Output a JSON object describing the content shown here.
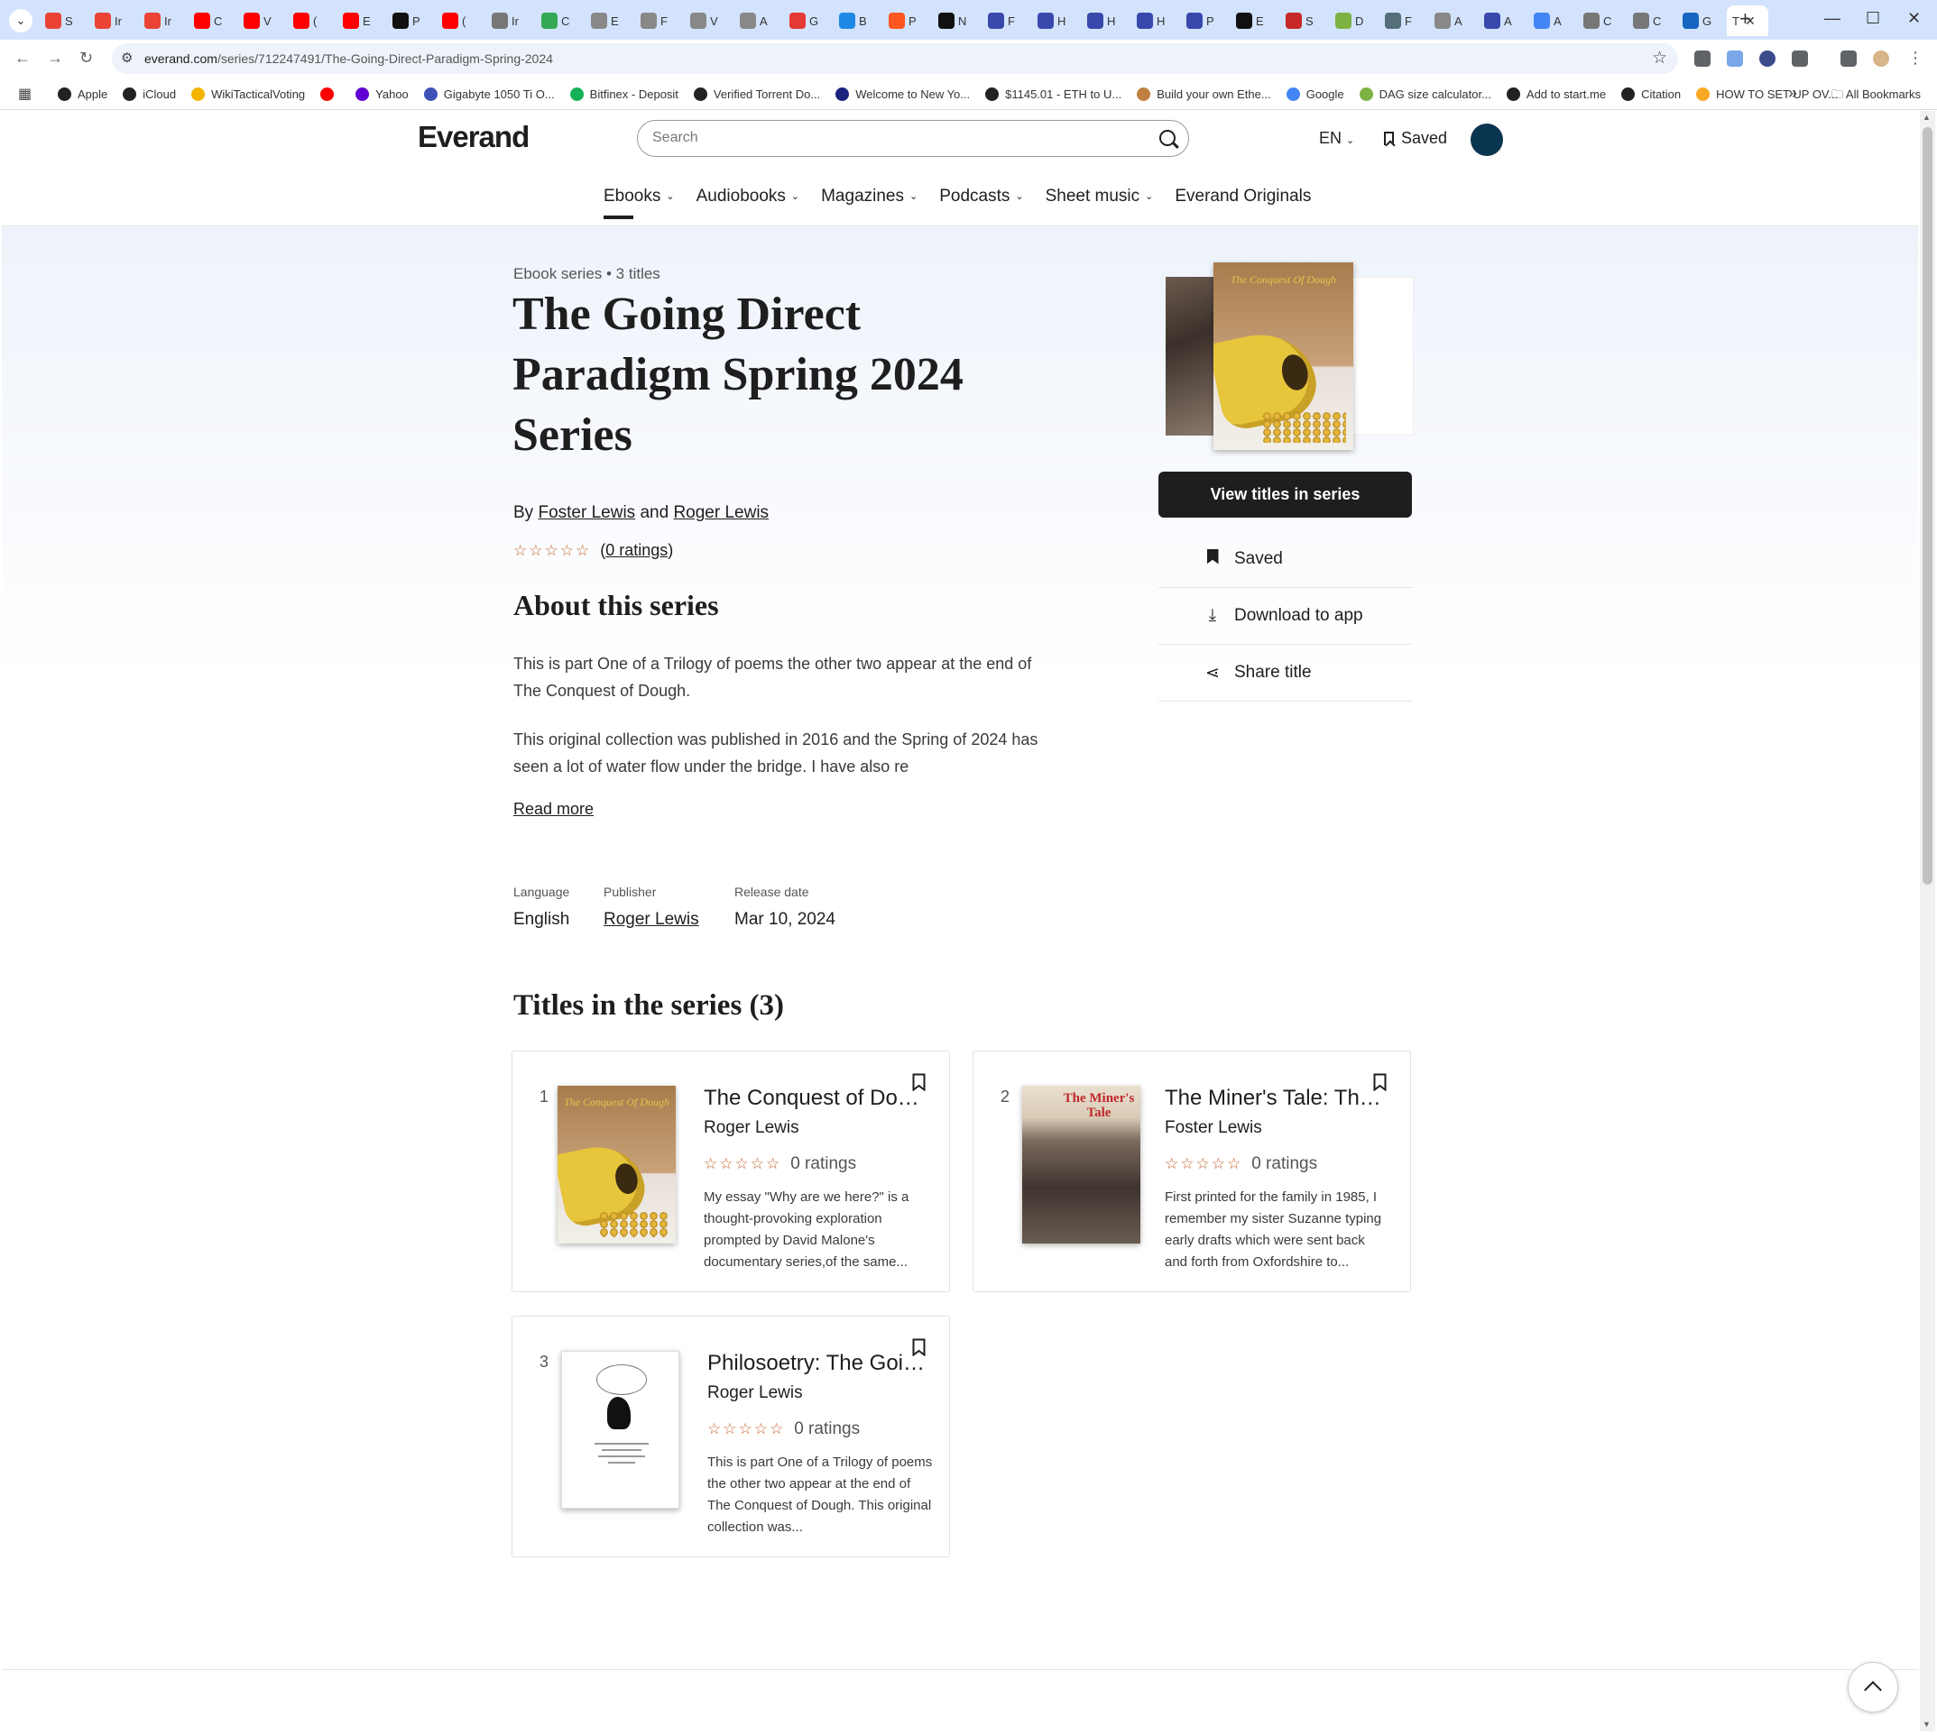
{
  "browser": {
    "tabs": [
      {
        "label": "S",
        "color": "#ea4335"
      },
      {
        "label": "Ir",
        "color": "#ea4335"
      },
      {
        "label": "Ir",
        "color": "#ea4335"
      },
      {
        "label": "C",
        "color": "#ff0000"
      },
      {
        "label": "V",
        "color": "#ff0000"
      },
      {
        "label": "(",
        "color": "#ff0000"
      },
      {
        "label": "E",
        "color": "#ff0000"
      },
      {
        "label": "P",
        "color": "#111111"
      },
      {
        "label": "(",
        "color": "#ff0000"
      },
      {
        "label": "Ir",
        "color": "#777777"
      },
      {
        "label": "C",
        "color": "#34a853"
      },
      {
        "label": "E",
        "color": "#888888"
      },
      {
        "label": "F",
        "color": "#888888"
      },
      {
        "label": "V",
        "color": "#888888"
      },
      {
        "label": "A",
        "color": "#888888"
      },
      {
        "label": "G",
        "color": "#e53935"
      },
      {
        "label": "B",
        "color": "#1e88e5"
      },
      {
        "label": "P",
        "color": "#ff5722"
      },
      {
        "label": "N",
        "color": "#111111"
      },
      {
        "label": "F",
        "color": "#3949ab"
      },
      {
        "label": "H",
        "color": "#3949ab"
      },
      {
        "label": "H",
        "color": "#3949ab"
      },
      {
        "label": "H",
        "color": "#3949ab"
      },
      {
        "label": "P",
        "color": "#3949ab"
      },
      {
        "label": "E",
        "color": "#111111"
      },
      {
        "label": "S",
        "color": "#c62828"
      },
      {
        "label": "D",
        "color": "#7cb342"
      },
      {
        "label": "F",
        "color": "#546e7a"
      },
      {
        "label": "A",
        "color": "#888888"
      },
      {
        "label": "A",
        "color": "#3949ab"
      },
      {
        "label": "A",
        "color": "#4285f4"
      },
      {
        "label": "C",
        "color": "#777777"
      },
      {
        "label": "C",
        "color": "#777777"
      },
      {
        "label": "G",
        "color": "#1565c0"
      }
    ],
    "active_tab": {
      "label": "T",
      "close": "✕"
    },
    "new_tab": "+",
    "url_host": "everand.com",
    "url_path": "/series/712247491/The-Going-Direct-Paradigm-Spring-2024",
    "bookmarks": [
      {
        "label": "Apple",
        "color": "#222222"
      },
      {
        "label": "iCloud",
        "color": "#222222"
      },
      {
        "label": "WikiTacticalVoting",
        "color": "#f4b400"
      },
      {
        "label": "",
        "color": "#ff0000"
      },
      {
        "label": "Yahoo",
        "color": "#6001d2"
      },
      {
        "label": "Gigabyte 1050 Ti O...",
        "color": "#3f51b5"
      },
      {
        "label": "Bitfinex - Deposit",
        "color": "#16b157"
      },
      {
        "label": "Verified Torrent Do...",
        "color": "#222222"
      },
      {
        "label": "Welcome to New Yo...",
        "color": "#1a237e"
      },
      {
        "label": "$1145.01 - ETH to U...",
        "color": "#222222"
      },
      {
        "label": "Build your own Ethe...",
        "color": "#bf8040"
      },
      {
        "label": "Google",
        "color": "#4285f4"
      },
      {
        "label": "DAG size calculator...",
        "color": "#7cb342"
      },
      {
        "label": "Add to start.me",
        "color": "#222222"
      },
      {
        "label": "Citation",
        "color": "#222222"
      },
      {
        "label": "HOW TO SET UP OV...",
        "color": "#f9a825"
      }
    ],
    "bookmarks_more": "»",
    "all_bookmarks": "All Bookmarks"
  },
  "header": {
    "logo": "Everand",
    "search_placeholder": "Search",
    "language": "EN",
    "saved": "Saved"
  },
  "categories": [
    {
      "label": "Ebooks",
      "caret": true
    },
    {
      "label": "Audiobooks",
      "caret": true
    },
    {
      "label": "Magazines",
      "caret": true
    },
    {
      "label": "Podcasts",
      "caret": true
    },
    {
      "label": "Sheet music",
      "caret": true
    },
    {
      "label": "Everand Originals",
      "caret": false
    }
  ],
  "series": {
    "crumb": "Ebook series • 3 titles",
    "title": "The Going Direct Paradigm Spring 2024 Series",
    "by": "By",
    "and": "and",
    "author1": "Foster Lewis",
    "author2": "Roger Lewis",
    "stars": "☆☆☆☆☆",
    "ratings_link": "0 ratings",
    "about_heading": "About this series",
    "desc1": "This is part One of a Trilogy of poems the other two appear at the end of The Conquest of Dough.",
    "desc2": "This original collection was published in 2016 and the Spring of 2024 has seen a lot of water flow under the bridge. I have also re",
    "read_more": "Read more",
    "meta": {
      "language_label": "Language",
      "language": "English",
      "publisher_label": "Publisher",
      "publisher": "Roger Lewis",
      "release_label": "Release date",
      "release": "Mar 10, 2024"
    },
    "cover_title": "The Conquest Of Dough"
  },
  "actions": {
    "view_titles": "View titles in series",
    "saved": "Saved",
    "download": "Download to app",
    "share": "Share title"
  },
  "titles_heading": "Titles in the series (3)",
  "titles": [
    {
      "num": "1",
      "title": "The Conquest of Dough: Essays on Economics",
      "author": "Roger Lewis",
      "stars": "☆☆☆☆☆",
      "ratings": "0 ratings",
      "desc": "My essay \"Why are we here?\" is a thought-provoking exploration prompted by David Malone's documentary series,of the same...",
      "cover_title": "The Conquest Of Dough"
    },
    {
      "num": "2",
      "title": "The Miner's Tale: The Story of a Family",
      "author": "Foster Lewis",
      "stars": "☆☆☆☆☆",
      "ratings": "0 ratings",
      "desc": "First printed for the family in 1985, I remember my sister Suzanne typing early drafts which were sent back and forth from Oxfordshire to...",
      "cover_title": "The Miner's Tale"
    },
    {
      "num": "3",
      "title": "Philosoetry: The Going Direct Paradigm",
      "author": "Roger Lewis",
      "stars": "☆☆☆☆☆",
      "ratings": "0 ratings",
      "desc": "This is part One of a Trilogy of poems the other two appear at the end of The Conquest of Dough. This original collection was...",
      "cover_title": ""
    }
  ]
}
